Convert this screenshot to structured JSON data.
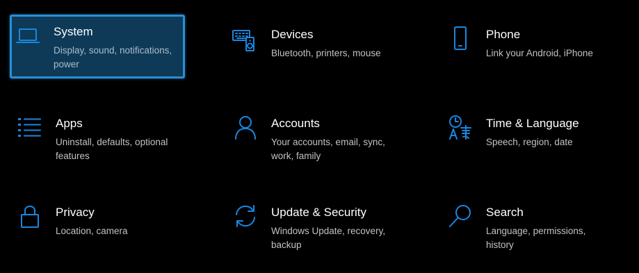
{
  "accent_color": "#1a86e0",
  "selected_tile": "System",
  "tiles": [
    {
      "title": "System",
      "description": "Display, sound, notifications, power",
      "icon": "laptop-icon"
    },
    {
      "title": "Devices",
      "description": "Bluetooth, printers, mouse",
      "icon": "keyboard-speaker-icon"
    },
    {
      "title": "Phone",
      "description": "Link your Android, iPhone",
      "icon": "phone-icon"
    },
    {
      "title": "Apps",
      "description": "Uninstall, defaults, optional features",
      "icon": "apps-list-icon"
    },
    {
      "title": "Accounts",
      "description": "Your accounts, email, sync, work, family",
      "icon": "person-icon"
    },
    {
      "title": "Time & Language",
      "description": "Speech, region, date",
      "icon": "time-language-icon"
    },
    {
      "title": "Privacy",
      "description": "Location, camera",
      "icon": "lock-icon"
    },
    {
      "title": "Update & Security",
      "description": "Windows Update, recovery, backup",
      "icon": "refresh-icon"
    },
    {
      "title": "Search",
      "description": "Language, permissions, history",
      "icon": "magnifier-icon"
    }
  ]
}
